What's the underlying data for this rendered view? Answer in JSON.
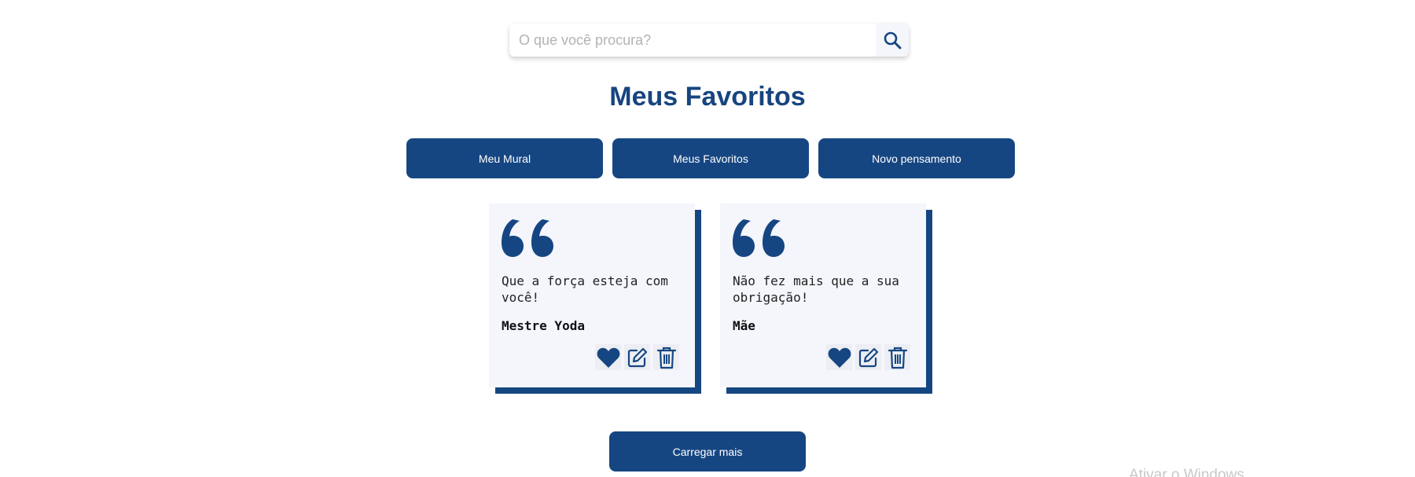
{
  "search": {
    "placeholder": "O que você procura?",
    "icon": "search-icon"
  },
  "title": "Meus Favoritos",
  "nav": {
    "mural": "Meu Mural",
    "favoritos": "Meus Favoritos",
    "novo": "Novo pensamento"
  },
  "cards": [
    {
      "text": "Que a força esteja com você!",
      "author": "Mestre Yoda"
    },
    {
      "text": "Não fez mais que a sua obrigação!",
      "author": "Mãe"
    }
  ],
  "actions": {
    "icons": [
      "heart-icon",
      "edit-icon",
      "trash-icon"
    ]
  },
  "load_more": "Carregar mais",
  "watermark": "Ativar o Windows",
  "colors": {
    "primary": "#164682",
    "card_bg": "#f4f6fc",
    "page_bg": "#ffffff"
  }
}
